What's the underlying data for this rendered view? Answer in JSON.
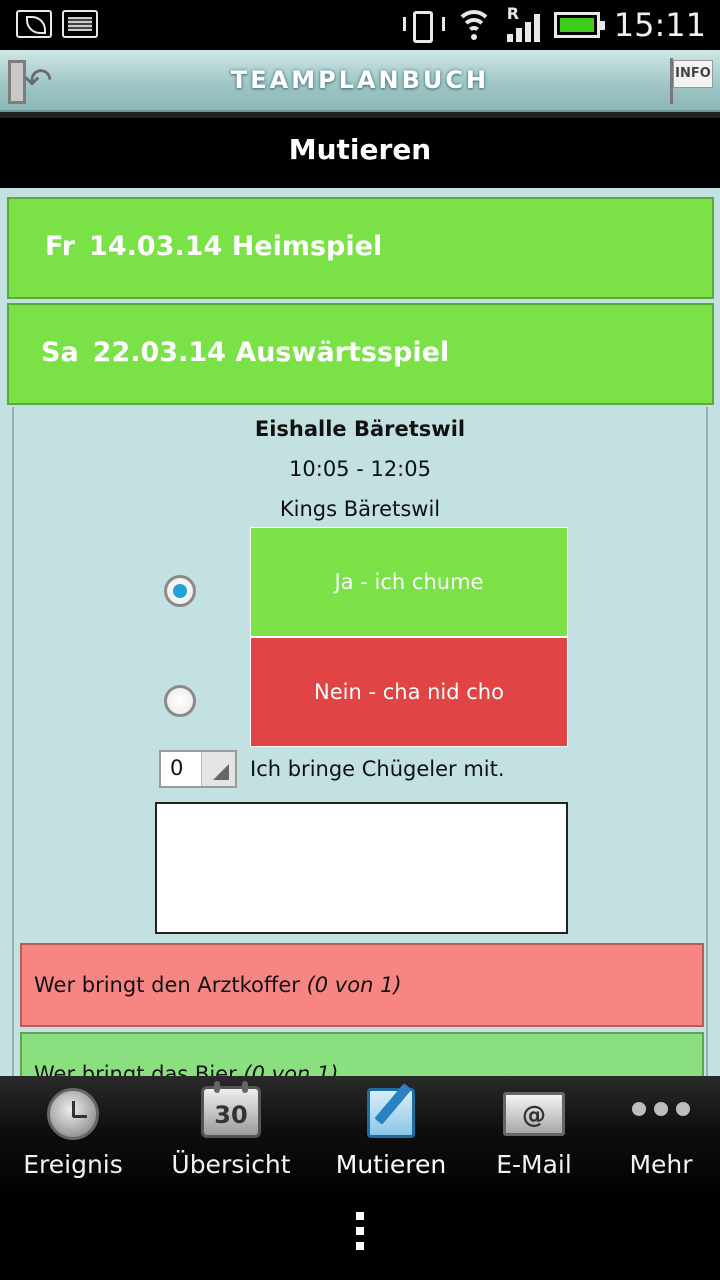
{
  "status_bar": {
    "time": "15:11",
    "network_indicator": "R",
    "icons": [
      "leaf-icon",
      "image-icon",
      "vibrate-icon",
      "wifi-icon",
      "signal-icon",
      "battery-icon"
    ],
    "battery_color": "#3fcc1d"
  },
  "app_bar": {
    "title": "TEAMPLANBUCH",
    "info_label": "INFO"
  },
  "page": {
    "title": "Mutieren"
  },
  "events": [
    {
      "day": "Fr",
      "date": "14.03.14",
      "type": "Heimspiel"
    },
    {
      "day": "Sa",
      "date": "22.03.14",
      "type": "Auswärtsspiel"
    }
  ],
  "detail": {
    "location": "Eishalle Bäretswil",
    "time_range": "10:05 - 12:05",
    "opponent": "Kings Bäretswil",
    "answers": [
      {
        "label": "Ja - ich chume",
        "selected": true,
        "color": "#7ae246"
      },
      {
        "label": "Nein - cha nid cho",
        "selected": false,
        "color": "#e04444"
      }
    ],
    "stepper_value": "0",
    "stepper_label": "Ich bringe Chügeler mit.",
    "notes_value": ""
  },
  "tasks": [
    {
      "label": "Wer bringt den Arztkoffer",
      "count": "(0 von 1)",
      "color": "#f78582"
    },
    {
      "label": "Wer bringt das Bier",
      "count": "(0 von 1)",
      "color": "#8ae07f"
    }
  ],
  "tabs": [
    {
      "label": "Ereignis",
      "icon": "alarm-clock-icon"
    },
    {
      "label": "Übersicht",
      "icon": "calendar-icon",
      "icon_text": "30"
    },
    {
      "label": "Mutieren",
      "icon": "edit-icon",
      "active": true
    },
    {
      "label": "E-Mail",
      "icon": "mail-icon",
      "icon_text": "@"
    },
    {
      "label": "Mehr",
      "icon": "more-dots-icon"
    }
  ]
}
